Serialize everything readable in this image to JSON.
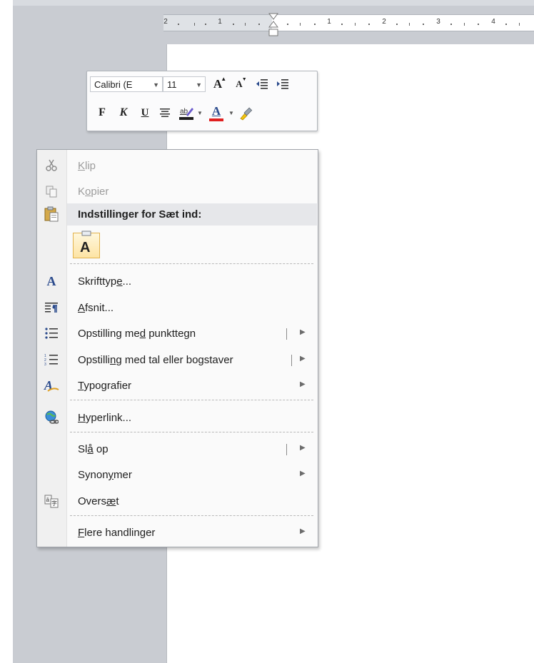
{
  "ruler": {
    "numbers": [
      "2",
      "1",
      "1",
      "2",
      "3",
      "4"
    ]
  },
  "mini_toolbar": {
    "font_name": "Calibri (E",
    "font_size": "11",
    "grow_font": "A",
    "shrink_font": "A",
    "bold": "F",
    "italic": "K",
    "underline": "U",
    "font_color": "A"
  },
  "context_menu": {
    "cut": {
      "before": "",
      "key": "K",
      "after": "lip"
    },
    "copy": {
      "before": "K",
      "key": "o",
      "after": "pier"
    },
    "paste_options_header": "Indstillinger for Sæt ind:",
    "paste_keep_text": "A",
    "font": {
      "before": "Skrifttyp",
      "key": "e",
      "after": "..."
    },
    "paragraph": {
      "before": "",
      "key": "A",
      "after": "fsnit..."
    },
    "bullets": {
      "before": "Opstilling me",
      "key": "d",
      "after": " punkttegn"
    },
    "numbering": {
      "before": "Opstilli",
      "key": "n",
      "after": "g med tal eller bogstaver"
    },
    "styles": {
      "before": "",
      "key": "T",
      "after": "ypografier"
    },
    "hyperlink": {
      "before": "",
      "key": "H",
      "after": "yperlink..."
    },
    "lookup": {
      "before": "Sl",
      "key": "å",
      "after": " op"
    },
    "synonyms": {
      "before": "Synon",
      "key": "y",
      "after": "mer"
    },
    "translate": {
      "before": "Overs",
      "key": "æ",
      "after": "t"
    },
    "more_actions": {
      "before": "",
      "key": "F",
      "after": "lere handlinger"
    }
  },
  "colors": {
    "workspace": "#c9ccd2",
    "menu_background": "#fafafa",
    "header_background": "#e6e7ea",
    "highlight_yellow": "#fde4a4",
    "font_color_red": "#e02020",
    "icon_blue": "#2a4a8c"
  }
}
